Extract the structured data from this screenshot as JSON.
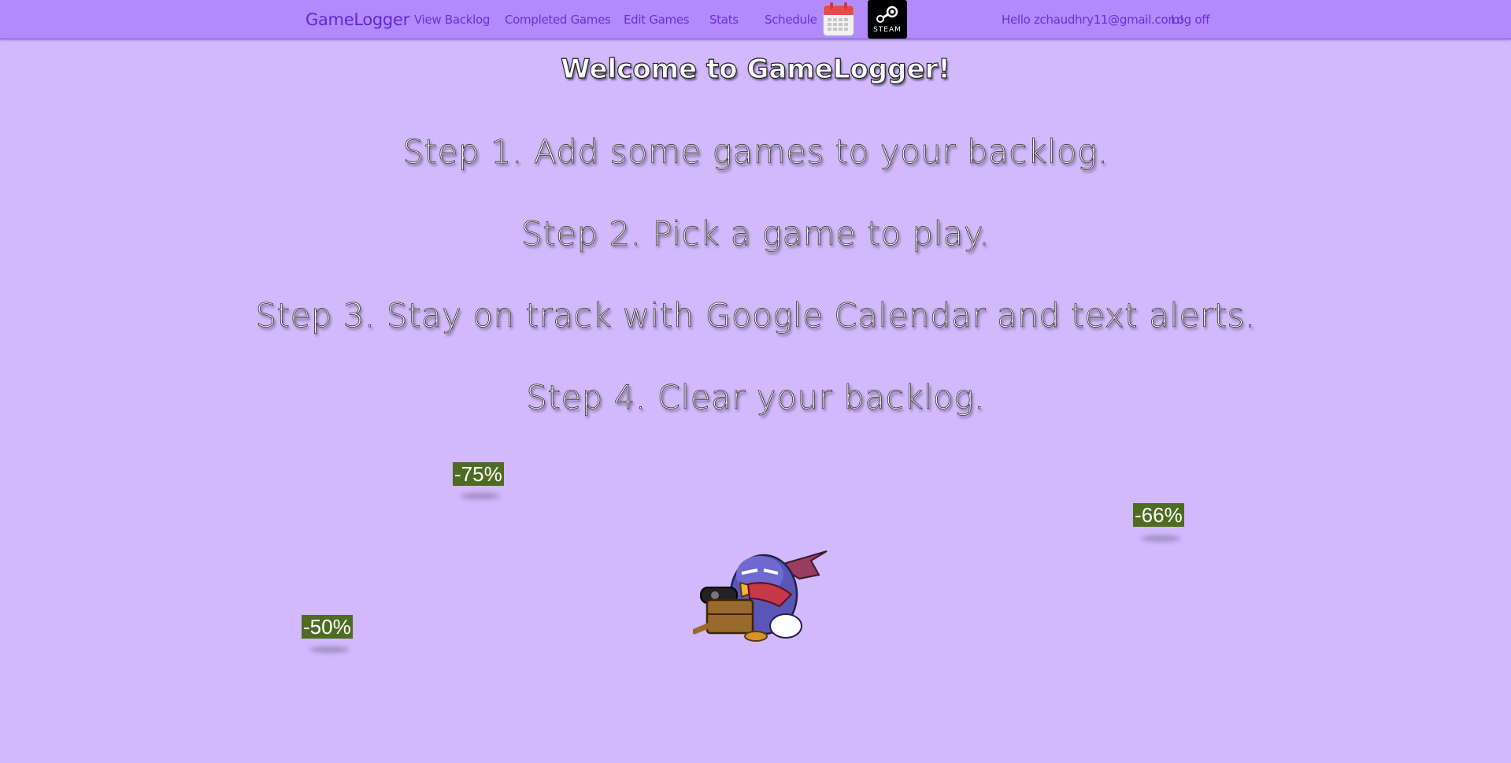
{
  "nav": {
    "brand": "GameLogger",
    "links": [
      "View Backlog",
      "Completed Games",
      "Edit Games",
      "Stats",
      "Schedule"
    ],
    "steam_label": "STEAM",
    "greeting": "Hello zchaudhry11@gmail.com!",
    "logoff": "Log off"
  },
  "main": {
    "welcome": "Welcome to GameLogger!",
    "steps": [
      "Step 1. Add some games to your backlog.",
      "Step 2. Pick a game to play.",
      "Step 3. Stay on track with Google Calendar and text alerts.",
      "Step 4. Clear your backlog."
    ]
  },
  "discounts": [
    "-75%",
    "-66%",
    "-50%"
  ],
  "icons": {
    "calendar": "calendar-icon",
    "steam": "steam-icon",
    "mascot": "prinny-mascot"
  },
  "colors": {
    "background": "#d2b8fc",
    "navbar": "#b18afb",
    "nav_text": "#6a2fd6",
    "discount_bg": "#4d6b22"
  }
}
